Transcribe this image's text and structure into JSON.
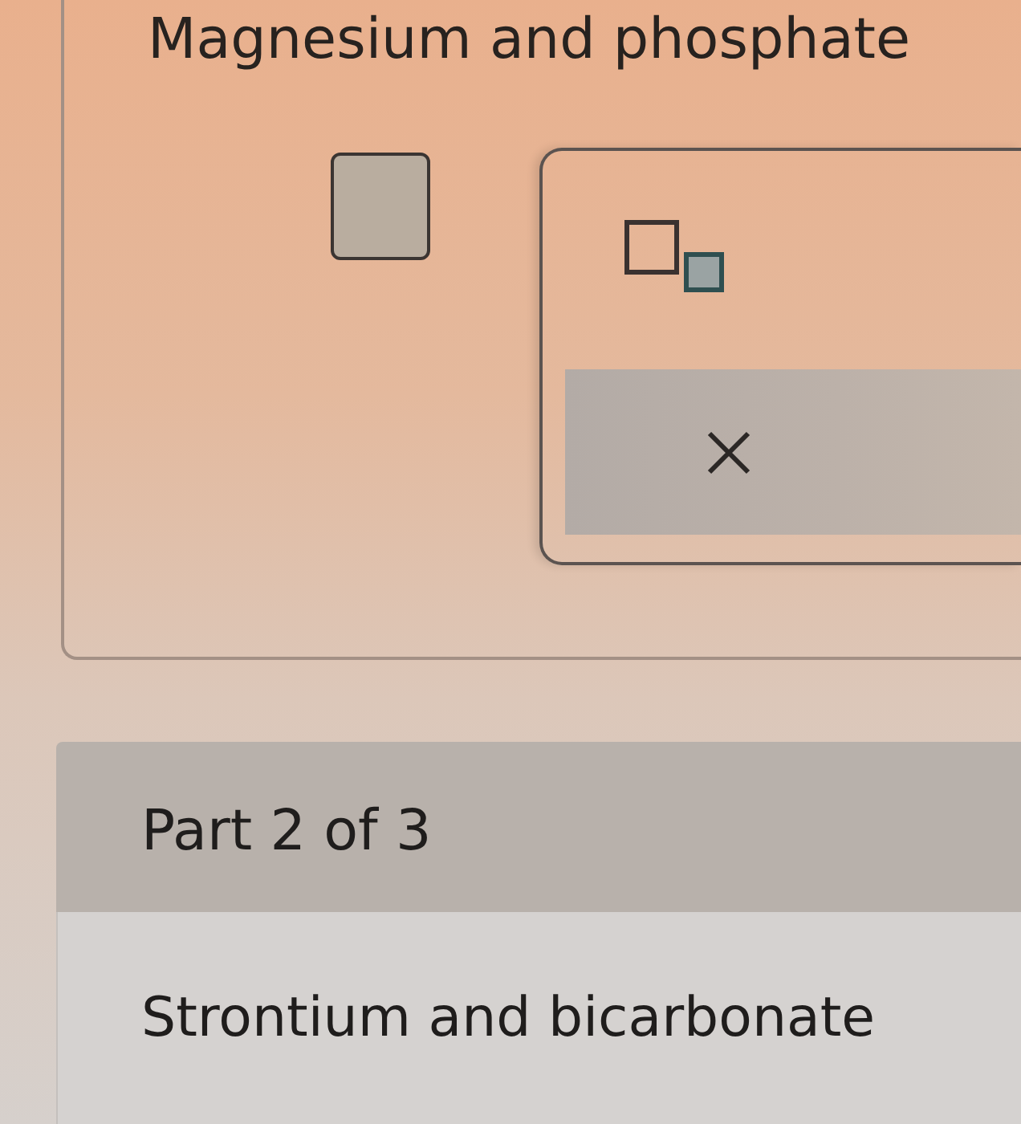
{
  "part_1": {
    "question": "Magnesium and phosphate"
  },
  "part_2": {
    "header": "Part 2 of 3",
    "question": "Strontium and bicarbonate"
  }
}
